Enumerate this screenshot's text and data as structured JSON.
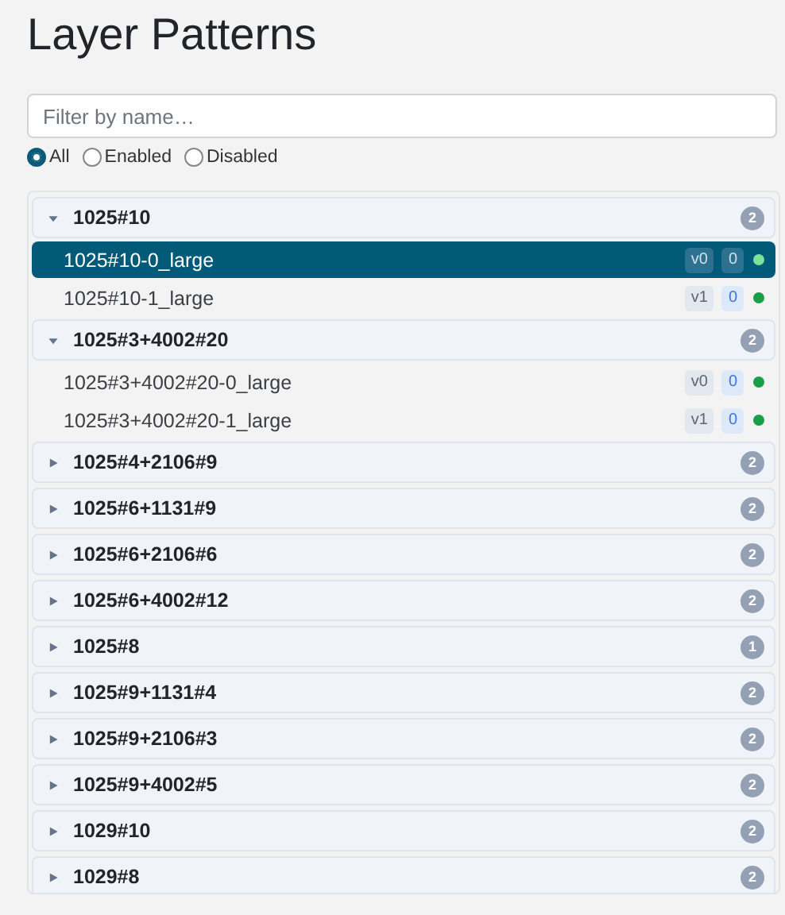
{
  "title": "Layer Patterns",
  "search": {
    "placeholder": "Filter by name…"
  },
  "filters": [
    {
      "label": "All",
      "selected": true
    },
    {
      "label": "Enabled",
      "selected": false
    },
    {
      "label": "Disabled",
      "selected": false
    }
  ],
  "groups": [
    {
      "name": "1025#10",
      "count": "2",
      "expanded": true,
      "items": [
        {
          "name": "1025#10-0_large",
          "version": "v0",
          "count": "0",
          "enabled": true,
          "selected": true
        },
        {
          "name": "1025#10-1_large",
          "version": "v1",
          "count": "0",
          "enabled": true,
          "selected": false
        }
      ]
    },
    {
      "name": "1025#3+4002#20",
      "count": "2",
      "expanded": true,
      "items": [
        {
          "name": "1025#3+4002#20-0_large",
          "version": "v0",
          "count": "0",
          "enabled": true,
          "selected": false
        },
        {
          "name": "1025#3+4002#20-1_large",
          "version": "v1",
          "count": "0",
          "enabled": true,
          "selected": false
        }
      ]
    },
    {
      "name": "1025#4+2106#9",
      "count": "2",
      "expanded": false
    },
    {
      "name": "1025#6+1131#9",
      "count": "2",
      "expanded": false
    },
    {
      "name": "1025#6+2106#6",
      "count": "2",
      "expanded": false
    },
    {
      "name": "1025#6+4002#12",
      "count": "2",
      "expanded": false
    },
    {
      "name": "1025#8",
      "count": "1",
      "expanded": false
    },
    {
      "name": "1025#9+1131#4",
      "count": "2",
      "expanded": false
    },
    {
      "name": "1025#9+2106#3",
      "count": "2",
      "expanded": false
    },
    {
      "name": "1025#9+4002#5",
      "count": "2",
      "expanded": false
    },
    {
      "name": "1029#10",
      "count": "2",
      "expanded": false
    },
    {
      "name": "1029#8",
      "count": "2",
      "expanded": false
    }
  ]
}
